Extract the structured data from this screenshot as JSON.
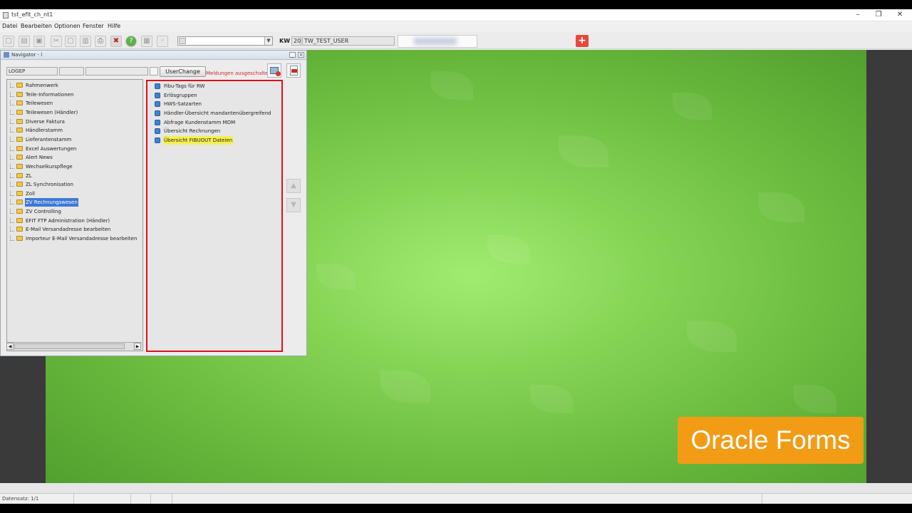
{
  "window": {
    "title": "tst_efit_ch_nt1",
    "controls": [
      "–",
      "❐",
      "✕"
    ]
  },
  "menu": [
    "Datei",
    "Bearbeiten",
    "Optionen",
    "Fenster",
    "Hilfe"
  ],
  "toolbar": {
    "kw_label": "KW",
    "kw_value": "20",
    "user": "TW_TEST_USER",
    "plus": "+"
  },
  "navigator": {
    "title": "Navigator - l",
    "field1": "LOGEP",
    "userchange_label": "UserChange",
    "meldungen": "Meldungen ausgeschaltet",
    "tree": [
      "Rahmenwerk",
      "Teile-Informationen",
      "Teilewesen",
      "Teilewesen (Händler)",
      "Diverse Faktura",
      "Händlerstamm",
      "Lieferantenstamm",
      "Excel Auswertungen",
      "Alert News",
      "Wechselkurspflege",
      "ZL",
      "ZL Synchronisation",
      "Zoll",
      "ZV Rechnungswesen",
      "ZV Controlling",
      "EFIT FTP Administration (Händler)",
      "E-Mail Versandadresse bearbeiten",
      "Importeur E-Mail Versandadresse bearbeiten"
    ],
    "selected_index": 13,
    "list": [
      "Fibu-Tags für RW",
      "Erlösgruppen",
      "HWS-Satzarten",
      "Händler-Übersicht mandantenübergreifend",
      "Abfrage Kundenstamm MDM",
      "Übersicht Rechnungen",
      "Übersicht FIBUOUT Dateien"
    ],
    "highlighted_index": 6
  },
  "badge": "Oracle Forms",
  "status": {
    "record": "Datensatz: 1/1"
  },
  "colors": {
    "highlight": "#f6ef52",
    "selection": "#3c79d6",
    "frame": "#e0101e",
    "badge": "#f29c16"
  }
}
